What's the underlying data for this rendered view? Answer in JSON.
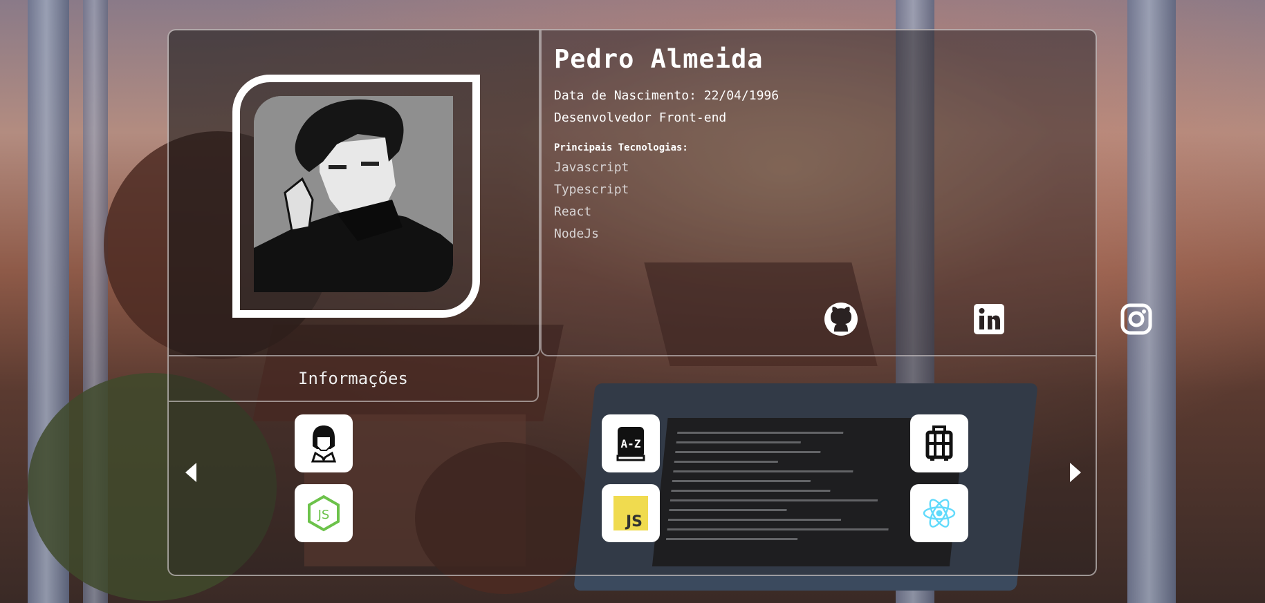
{
  "profile": {
    "name": "Pedro Almeida",
    "birth_date": "Data de Nascimento: 22/04/1996",
    "role": "Desenvolvedor Front-end",
    "tech_title": "Principais Tecnologias:",
    "technologies": [
      "Javascript",
      "Typescript",
      "React",
      "NodeJs"
    ]
  },
  "social": [
    {
      "icon": "github-icon"
    },
    {
      "icon": "linkedin-icon"
    },
    {
      "icon": "instagram-icon"
    }
  ],
  "tabs": {
    "info_label": "Informações"
  },
  "carousel": {
    "tiles": [
      {
        "icon": "avatar-portrait-icon"
      },
      {
        "icon": "dictionary-icon"
      },
      {
        "icon": "luggage-icon"
      },
      {
        "icon": "nodejs-icon"
      },
      {
        "icon": "javascript-icon"
      },
      {
        "icon": "react-icon"
      }
    ],
    "prev": "chevron-left-icon",
    "next": "chevron-right-icon"
  },
  "colors": {
    "nodejs_green": "#6cc24a",
    "js_yellow": "#f0db4f",
    "react_blue": "#61dafb",
    "border": "#d7d2d2"
  }
}
